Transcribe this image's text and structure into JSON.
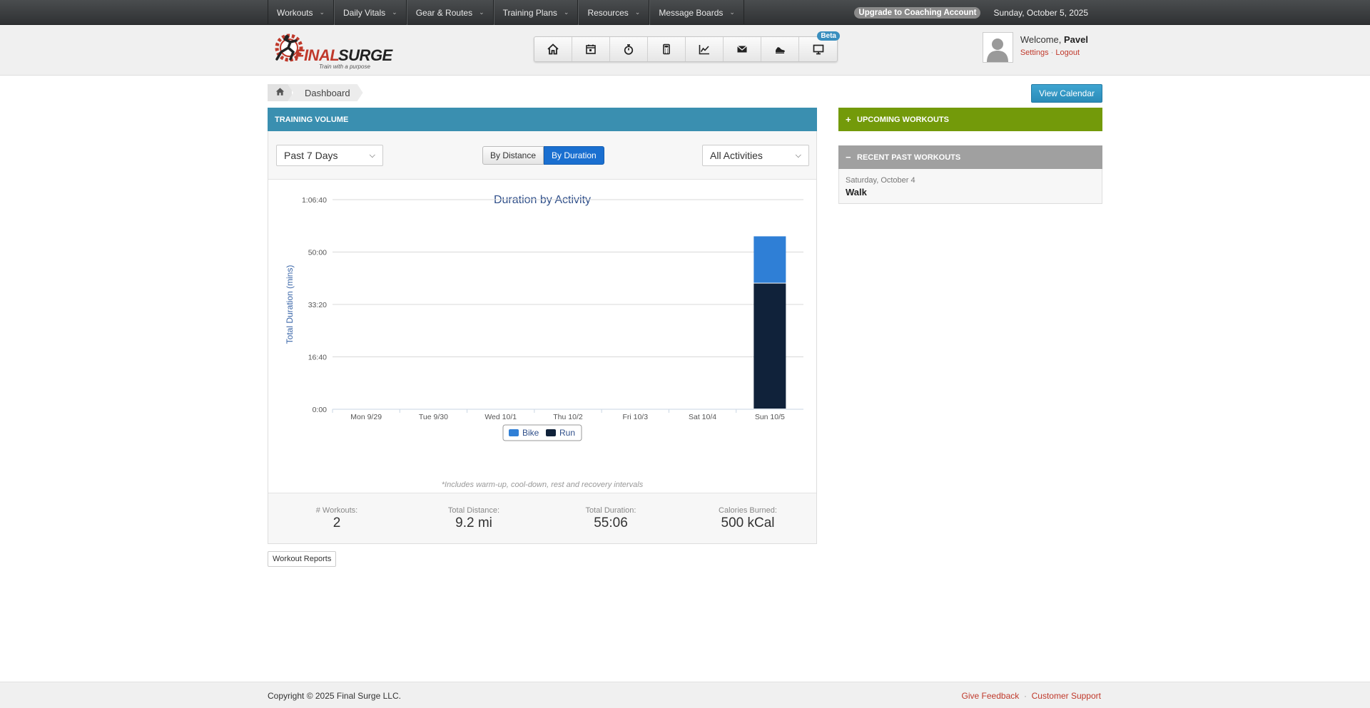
{
  "topnav": {
    "items": [
      {
        "label": "Workouts"
      },
      {
        "label": "Daily Vitals"
      },
      {
        "label": "Gear & Routes"
      },
      {
        "label": "Training Plans"
      },
      {
        "label": "Resources"
      },
      {
        "label": "Message Boards"
      }
    ],
    "upgrade_label": "Upgrade to Coaching Account",
    "date": "Sunday, October 5, 2025"
  },
  "logo": {
    "brand": "FINAL SURGE",
    "tagline": "Train with a purpose"
  },
  "iconbar": {
    "icons": [
      "home-icon",
      "calendar-icon",
      "stopwatch-icon",
      "calculator-icon",
      "chart-icon",
      "mail-icon",
      "shoe-icon",
      "monitor-icon"
    ],
    "beta_label": "Beta"
  },
  "user": {
    "welcome": "Welcome,",
    "name": "Pavel",
    "settings_label": "Settings",
    "separator": "·",
    "logout_label": "Logout"
  },
  "breadcrumb": {
    "page": "Dashboard"
  },
  "view_calendar_label": "View Calendar",
  "training_volume": {
    "title": "TRAINING VOLUME",
    "period_select": "Past 7 Days",
    "toggle": {
      "distance": "By Distance",
      "duration": "By Duration"
    },
    "activity_select": "All Activities",
    "footnote": "*Includes warm-up, cool-down, rest and recovery intervals"
  },
  "chart_data": {
    "type": "bar",
    "title": "Duration by Activity",
    "ylabel": "Total Duration (mins)",
    "xlabel": "",
    "categories": [
      "Mon 9/29",
      "Tue 9/30",
      "Wed 10/1",
      "Thu 10/2",
      "Fri 10/3",
      "Sat 10/4",
      "Sun 10/5"
    ],
    "y_ticks": [
      "0:00",
      "16:40",
      "33:20",
      "50:00",
      "1:06:40"
    ],
    "y_tick_values": [
      0,
      16.667,
      33.333,
      50,
      66.667
    ],
    "ylim": [
      0,
      66.667
    ],
    "stacked": true,
    "series": [
      {
        "name": "Run",
        "color": "#10223a",
        "values": [
          0,
          0,
          0,
          0,
          0,
          0,
          40
        ]
      },
      {
        "name": "Bike",
        "color": "#2f7fd6",
        "values": [
          0,
          0,
          0,
          0,
          0,
          0,
          15
        ]
      }
    ],
    "legend": "bottom",
    "grid": true
  },
  "stats": [
    {
      "label": "# Workouts:",
      "value": "2"
    },
    {
      "label": "Total Distance:",
      "value": "9.2 mi"
    },
    {
      "label": "Total Duration:",
      "value": "55:06"
    },
    {
      "label": "Calories Burned:",
      "value": "500 kCal"
    }
  ],
  "workout_reports_label": "Workout Reports",
  "upcoming": {
    "sign": "+",
    "title": "UPCOMING WORKOUTS"
  },
  "recent": {
    "sign": "−",
    "title": "RECENT PAST WORKOUTS",
    "items": [
      {
        "date": "Saturday, October 4",
        "name": "Walk"
      }
    ]
  },
  "footer": {
    "copyright": "Copyright © 2025 Final Surge LLC.",
    "feedback": "Give Feedback",
    "separator": "·",
    "support": "Customer Support"
  }
}
